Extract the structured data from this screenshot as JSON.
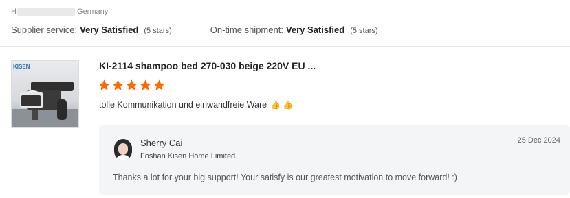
{
  "reviewer": {
    "name_initial": "H",
    "country": ",Germany"
  },
  "ratings": {
    "supplier_label": "Supplier service:",
    "supplier_value": "Very Satisfied",
    "supplier_stars": "(5 stars)",
    "shipment_label": "On-time shipment:",
    "shipment_value": "Very Satisfied",
    "shipment_stars": "(5 stars)"
  },
  "product": {
    "brand_mark": "KISEN",
    "title": "KI-2114 shampoo bed 270-030 beige 220V EU ...",
    "rating": 5,
    "star_color": "#ff6a00"
  },
  "review": {
    "text": "tolle Kommunikation und einwandfreie Ware",
    "emoji": "👍 👍"
  },
  "reply": {
    "seller_name": "Sherry Cai",
    "company": "Foshan Kisen Home Limited",
    "date": "25 Dec 2024",
    "text": "Thanks a lot for your big support! Your satisfy is our greatest motivation to move forward! :)"
  }
}
